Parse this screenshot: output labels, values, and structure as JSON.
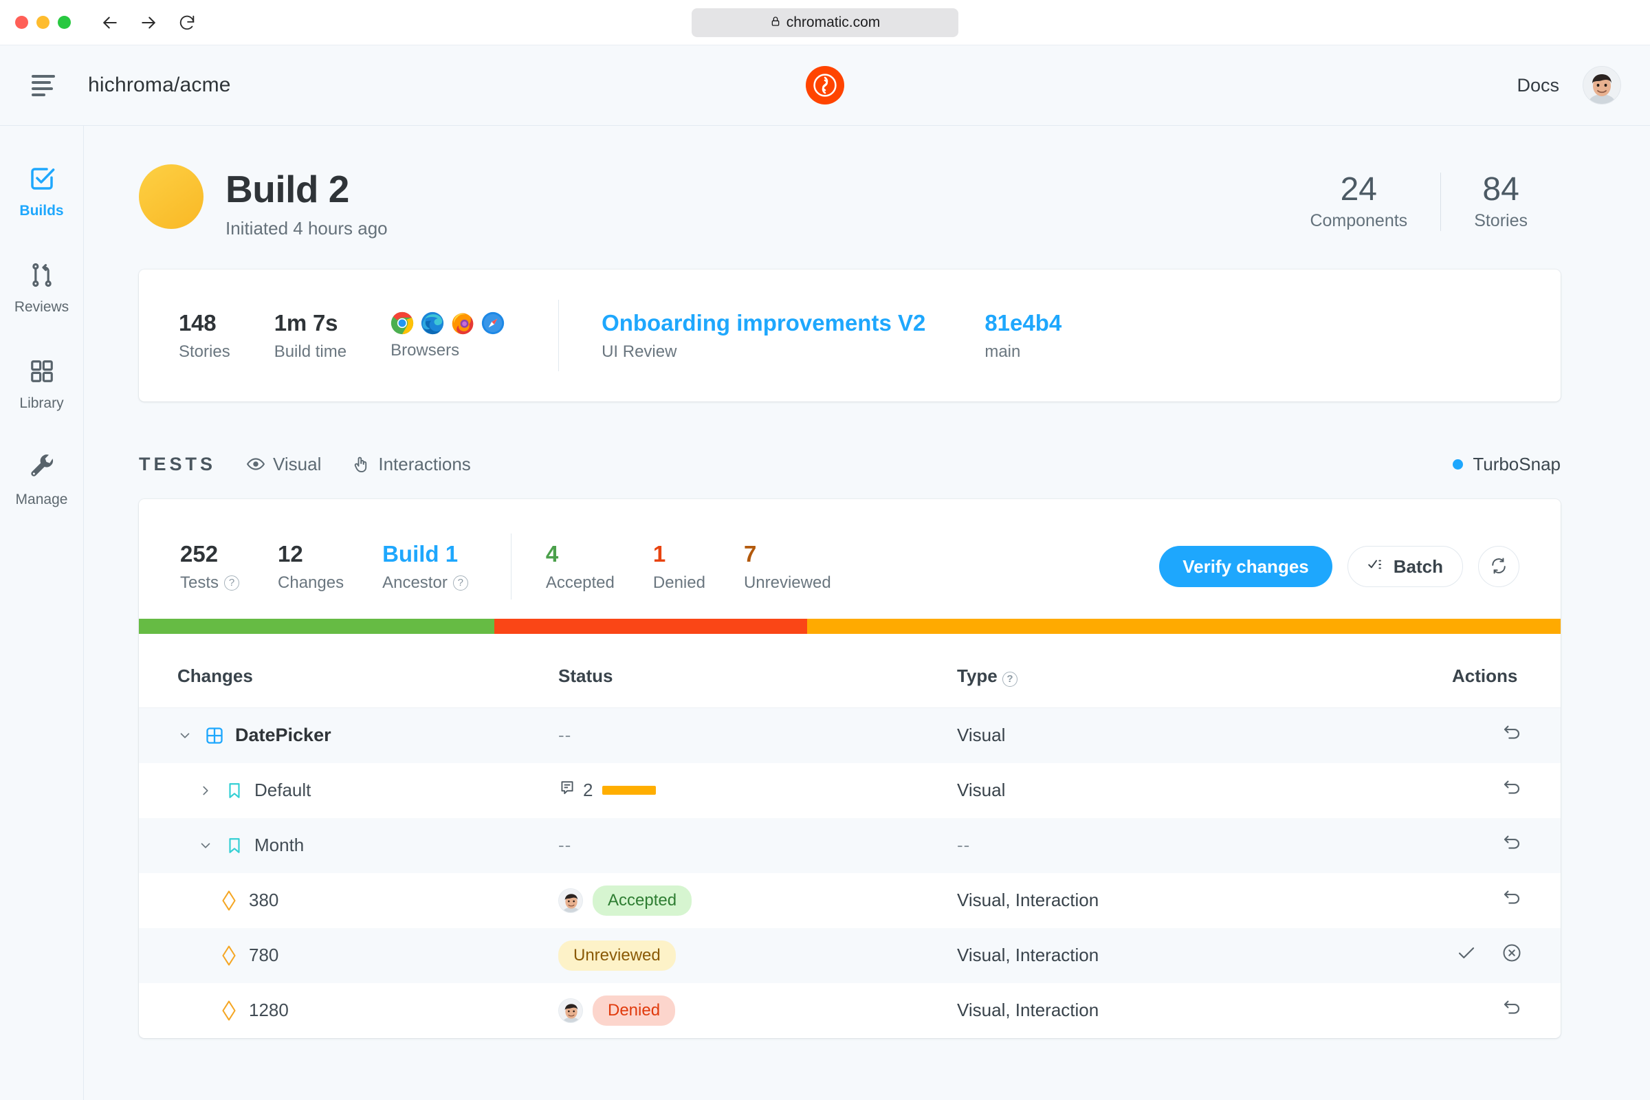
{
  "browser": {
    "url": "chromatic.com",
    "lock_icon": "lock-icon",
    "back_icon": "back-arrow-icon",
    "forward_icon": "forward-arrow-icon",
    "reload_icon": "reload-icon"
  },
  "appbar": {
    "menu_icon": "hamburger-menu-icon",
    "repo": "hichroma/acme",
    "logo_icon": "chromatic-logo-icon",
    "docs": "Docs",
    "avatar": "user-avatar"
  },
  "sidebar": {
    "items": [
      {
        "label": "Builds",
        "icon": "checkbox-icon",
        "active": true
      },
      {
        "label": "Reviews",
        "icon": "pull-request-icon",
        "active": false
      },
      {
        "label": "Library",
        "icon": "grid-icon",
        "active": false
      },
      {
        "label": "Manage",
        "icon": "wrench-icon",
        "active": false
      }
    ]
  },
  "build": {
    "title": "Build 2",
    "subtitle": "Initiated 4 hours ago",
    "status_color": "#fbc02d",
    "stats": [
      {
        "value": "24",
        "label": "Components"
      },
      {
        "value": "84",
        "label": "Stories"
      }
    ]
  },
  "info_card": {
    "metrics": [
      {
        "value": "148",
        "label": "Stories"
      },
      {
        "value": "1m 7s",
        "label": "Build time"
      }
    ],
    "browsers_label": "Browsers",
    "browsers": [
      "chrome-icon",
      "edge-icon",
      "firefox-icon",
      "safari-icon"
    ],
    "links": [
      {
        "value": "Onboarding improvements V2",
        "label": "UI Review"
      },
      {
        "value": "81e4b4",
        "label": "main"
      }
    ]
  },
  "tests": {
    "section_title": "TESTS",
    "tabs": [
      {
        "label": "Visual",
        "icon": "eye-icon"
      },
      {
        "label": "Interactions",
        "icon": "pointer-hand-icon"
      }
    ],
    "turbosnap": "TurboSnap",
    "turbosnap_color": "#1ea7fd",
    "metrics": [
      {
        "value": "252",
        "label": "Tests",
        "help": true,
        "kind": "plain"
      },
      {
        "value": "12",
        "label": "Changes",
        "help": false,
        "kind": "plain"
      },
      {
        "value": "Build 1",
        "label": "Ancestor",
        "help": true,
        "kind": "ancestor"
      }
    ],
    "review_metrics": [
      {
        "value": "4",
        "label": "Accepted",
        "kind": "accepted"
      },
      {
        "value": "1",
        "label": "Denied",
        "kind": "denied"
      },
      {
        "value": "7",
        "label": "Unreviewed",
        "kind": "unreviewed"
      }
    ],
    "actions": {
      "verify_label": "Verify changes",
      "batch_label": "Batch",
      "batch_icon": "checklist-icon",
      "refresh_icon": "refresh-icon"
    },
    "progress": [
      {
        "color": "#66bb44",
        "percent": 25
      },
      {
        "color": "#fa4616",
        "percent": 22
      },
      {
        "color": "#ffaa00",
        "percent": 53
      }
    ],
    "columns": [
      "Changes",
      "Status",
      "Type",
      "Actions"
    ],
    "type_help_icon": "question-icon",
    "rows": [
      {
        "name": "DatePicker",
        "indent": 0,
        "bold": true,
        "chevron": "chevron-down-icon",
        "icon": "component-icon",
        "status_kind": "dashes",
        "status_text": "--",
        "type": "Visual",
        "actions": [
          "undo-icon"
        ]
      },
      {
        "name": "Default",
        "indent": 1,
        "bold": false,
        "chevron": "chevron-right-icon",
        "icon": "story-icon",
        "status_kind": "comment-bar",
        "comment_count": "2",
        "type": "Visual",
        "actions": [
          "undo-icon"
        ]
      },
      {
        "name": "Month",
        "indent": 1,
        "bold": false,
        "chevron": "chevron-down-icon",
        "icon": "story-icon",
        "status_kind": "dashes",
        "status_text": "--",
        "type": "--",
        "actions": [
          "undo-icon"
        ]
      },
      {
        "name": "380",
        "indent": 2,
        "bold": false,
        "chevron": "",
        "icon": "snapshot-diamond-icon",
        "status_kind": "pill",
        "pill_label": "Accepted",
        "pill_style": "accepted",
        "avatar": true,
        "type": "Visual, Interaction",
        "actions": [
          "undo-icon"
        ]
      },
      {
        "name": "780",
        "indent": 2,
        "bold": false,
        "chevron": "",
        "icon": "snapshot-diamond-icon",
        "status_kind": "pill",
        "pill_label": "Unreviewed",
        "pill_style": "unreviewed",
        "avatar": false,
        "type": "Visual, Interaction",
        "actions": [
          "check-icon",
          "deny-circle-icon"
        ]
      },
      {
        "name": "1280",
        "indent": 2,
        "bold": false,
        "chevron": "",
        "icon": "snapshot-diamond-icon",
        "status_kind": "pill",
        "pill_label": "Denied",
        "pill_style": "denied",
        "avatar": true,
        "type": "Visual, Interaction",
        "actions": [
          "undo-icon"
        ]
      }
    ]
  }
}
